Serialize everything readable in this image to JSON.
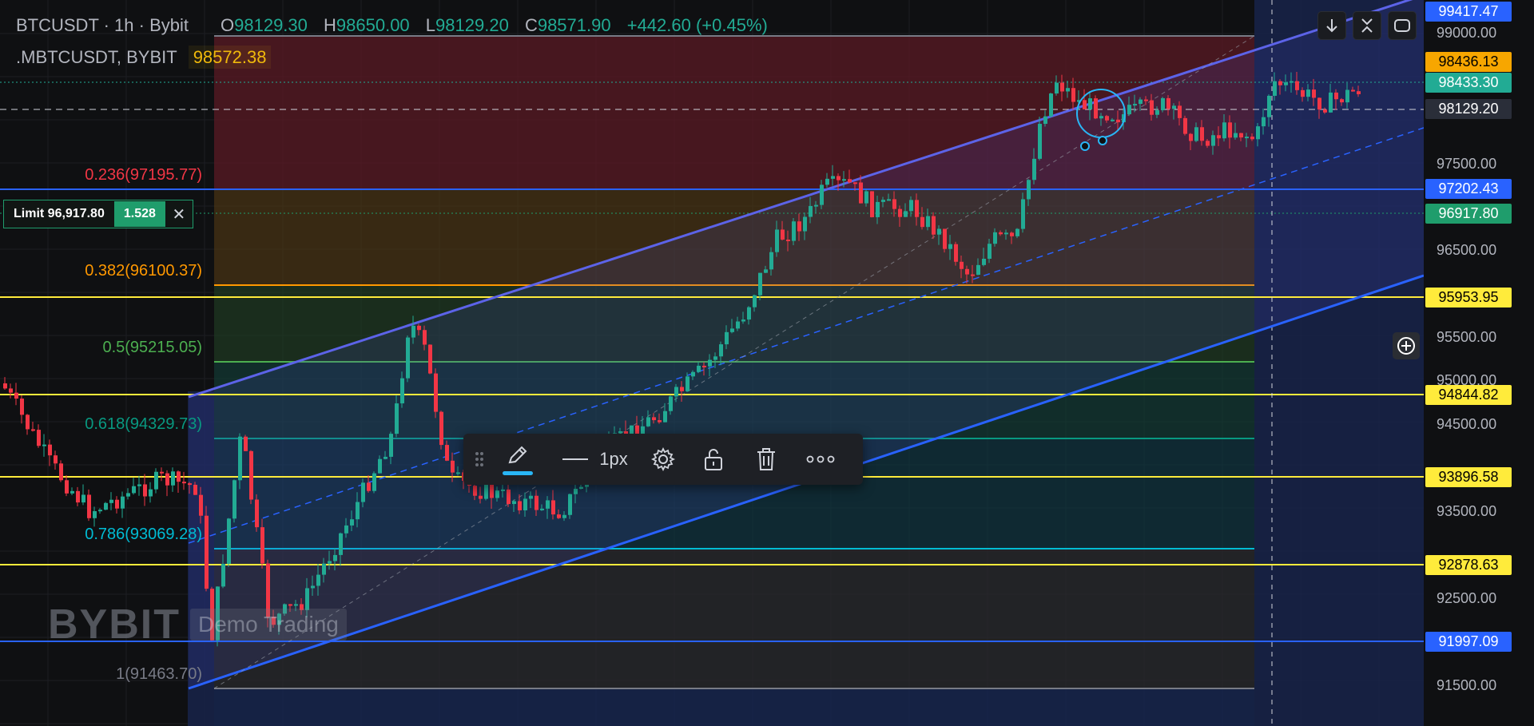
{
  "header": {
    "symbol": "BTCUSDT · 1h · Bybit",
    "ohlc": {
      "o_label": "O",
      "o": "98129.30",
      "h_label": "H",
      "h": "98650.00",
      "l_label": "L",
      "l": "98129.20",
      "c_label": "C",
      "c": "98571.90",
      "change": "+442.60 (+0.45%)"
    },
    "index_symbol": ".MBTCUSDT, BYBIT",
    "index_price": "98572.38"
  },
  "order": {
    "label": "Limit 96,917.80",
    "qty": "1.528"
  },
  "fib_levels": [
    {
      "label": "0.236(97195.77)",
      "color": "#f23645",
      "price": 97195.77
    },
    {
      "label": "0.382(96100.37)",
      "color": "#ff9800",
      "price": 96100.37
    },
    {
      "label": "0.5(95215.05)",
      "color": "#4caf50",
      "price": 95215.05
    },
    {
      "label": "0.618(94329.73)",
      "color": "#089981",
      "price": 94329.73
    },
    {
      "label": "0.786(93069.28)",
      "color": "#00bcd4",
      "price": 93069.28
    },
    {
      "label": "1(91463.70)",
      "color": "#787b86",
      "price": 91463.7
    }
  ],
  "axis": {
    "ticks": [
      "99000.00",
      "97500.00",
      "96500.00",
      "95500.00",
      "95000.00",
      "94500.00",
      "93500.00",
      "92500.00",
      "91500.00"
    ],
    "tags": [
      {
        "text": "99417.47",
        "bg": "#2962ff",
        "fg": "#ffffff"
      },
      {
        "text": "98436.13",
        "bg": "#f7a600",
        "fg": "#000000"
      },
      {
        "text": "98433.30",
        "bg": "#22ab94",
        "fg": "#ffffff"
      },
      {
        "text": "98129.20",
        "bg": "#2a2e39",
        "fg": "#ffffff"
      },
      {
        "text": "97202.43",
        "bg": "#2962ff",
        "fg": "#ffffff"
      },
      {
        "text": "96917.80",
        "bg": "#1f9d6c",
        "fg": "#ffffff"
      },
      {
        "text": "95953.95",
        "bg": "#ffeb3b",
        "fg": "#000000"
      },
      {
        "text": "94844.82",
        "bg": "#ffeb3b",
        "fg": "#000000"
      },
      {
        "text": "93896.58",
        "bg": "#ffeb3b",
        "fg": "#000000"
      },
      {
        "text": "92878.63",
        "bg": "#ffeb3b",
        "fg": "#000000"
      },
      {
        "text": "91997.09",
        "bg": "#2962ff",
        "fg": "#ffffff"
      }
    ]
  },
  "toolbar": {
    "width_label": "1px"
  },
  "watermark": {
    "logo": "BYBIT",
    "demo": "Demo Trading"
  },
  "colors": {
    "up": "#22ab94",
    "down": "#f23645",
    "channel": "#2962ff",
    "bg": "#0f1012"
  },
  "icons": [
    "drag-handle-icon",
    "pencil-icon",
    "line-width-icon",
    "gear-icon",
    "unlock-icon",
    "trash-icon",
    "more-icon",
    "arrow-down-icon",
    "collapse-icon",
    "fullscreen-icon",
    "plus-circle-icon",
    "close-icon"
  ]
}
